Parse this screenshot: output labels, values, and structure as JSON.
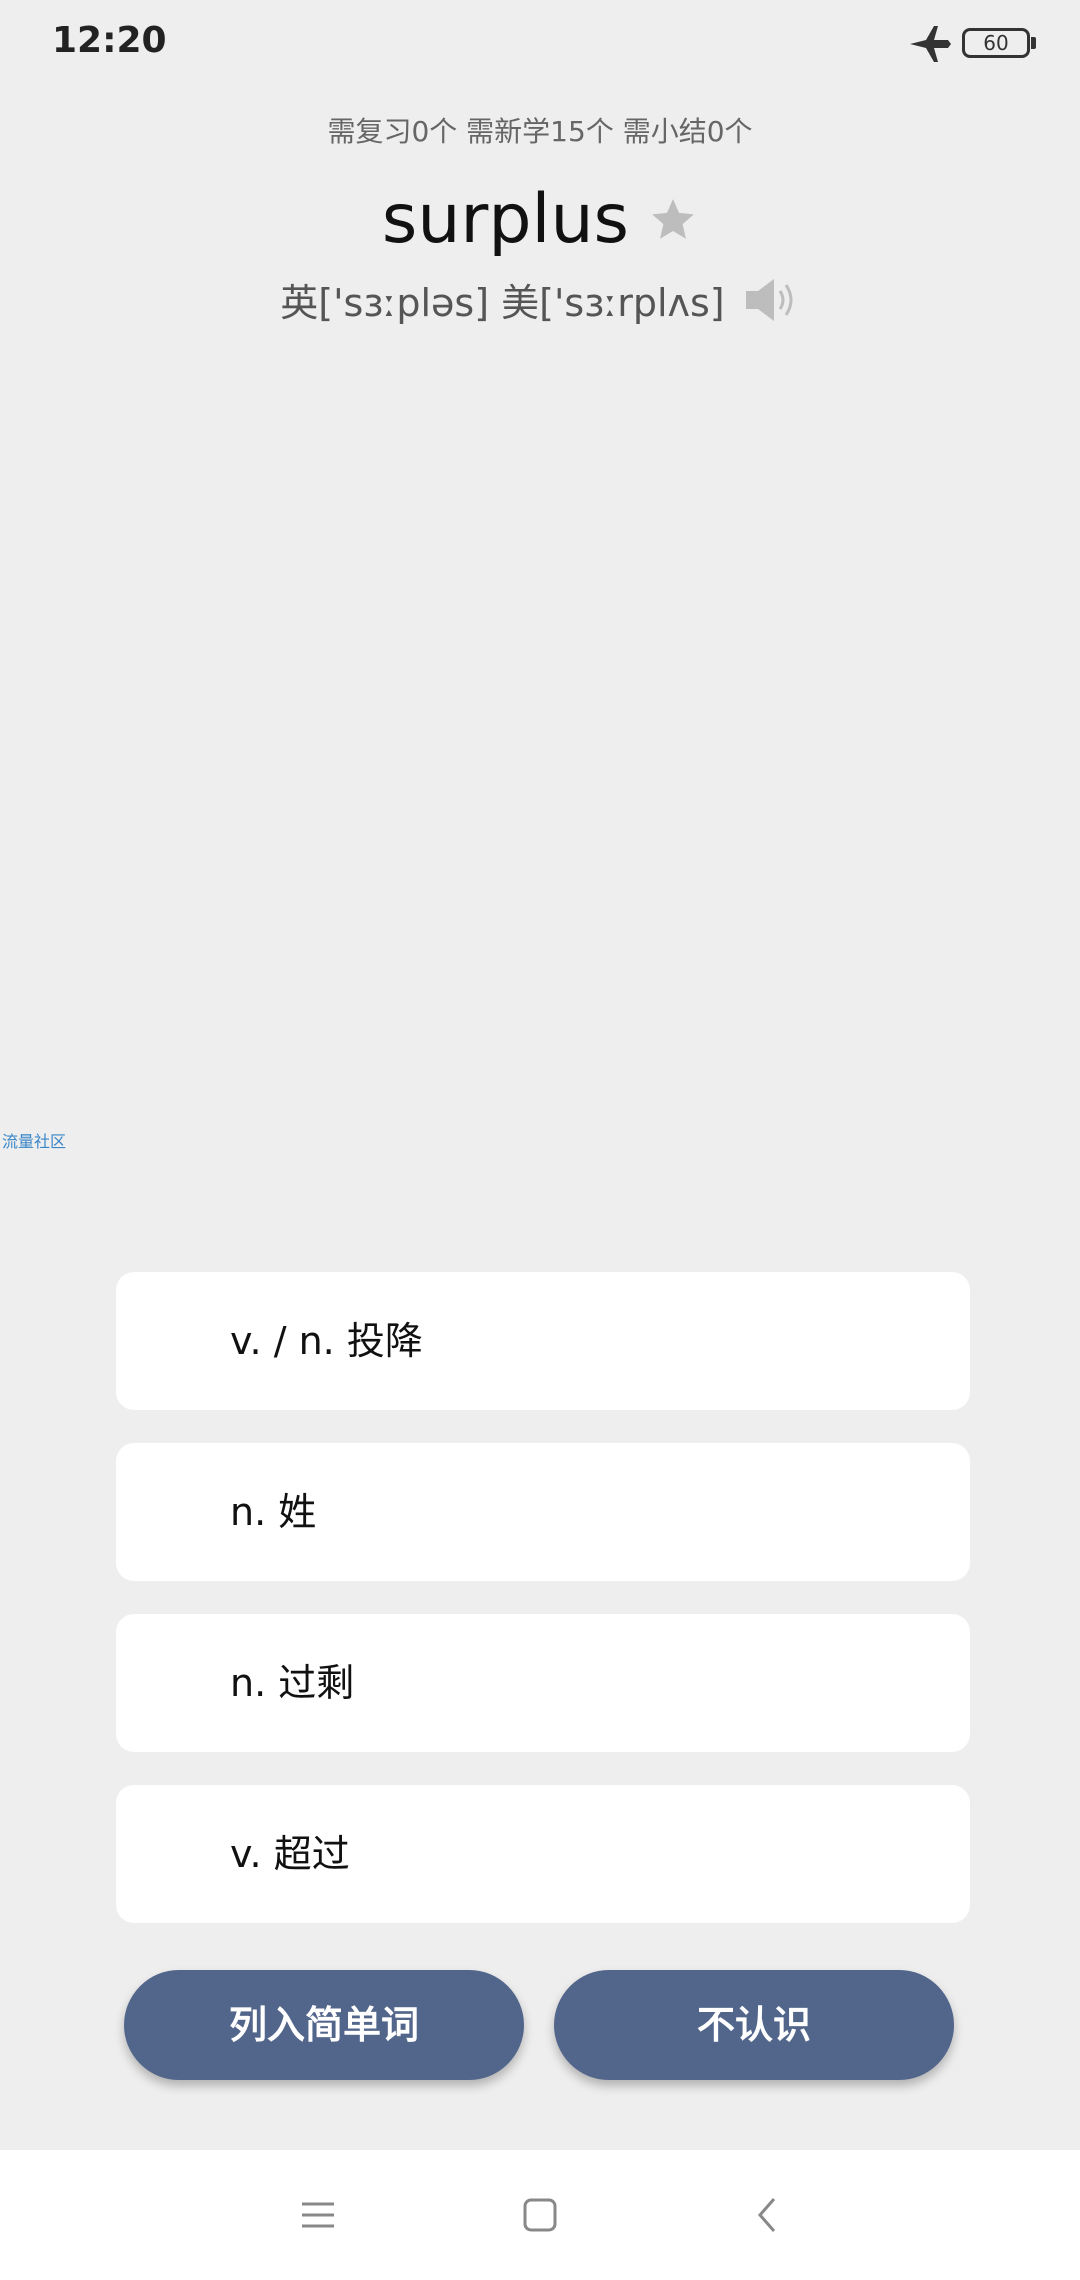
{
  "status_bar": {
    "time": "12:20",
    "battery": "60",
    "airplane_icon": "airplane-icon"
  },
  "progress": {
    "text": "需复习0个 需新学15个 需小结0个"
  },
  "word": {
    "text": "surplus",
    "star_icon": "star-icon",
    "phonetic": "英['sɜːpləs] 美['sɜːrplʌs]",
    "speaker_icon": "speaker-icon"
  },
  "watermark": "流量社区",
  "options": [
    {
      "label": "v. / n. 投降"
    },
    {
      "label": "n. 姓"
    },
    {
      "label": "n. 过剩"
    },
    {
      "label": "v. 超过"
    }
  ],
  "actions": {
    "easy_label": "列入简单词",
    "unknown_label": "不认识",
    "color": "#52658a"
  },
  "nav": {
    "menu_icon": "menu-icon",
    "home_icon": "home-icon",
    "back_icon": "back-icon"
  }
}
